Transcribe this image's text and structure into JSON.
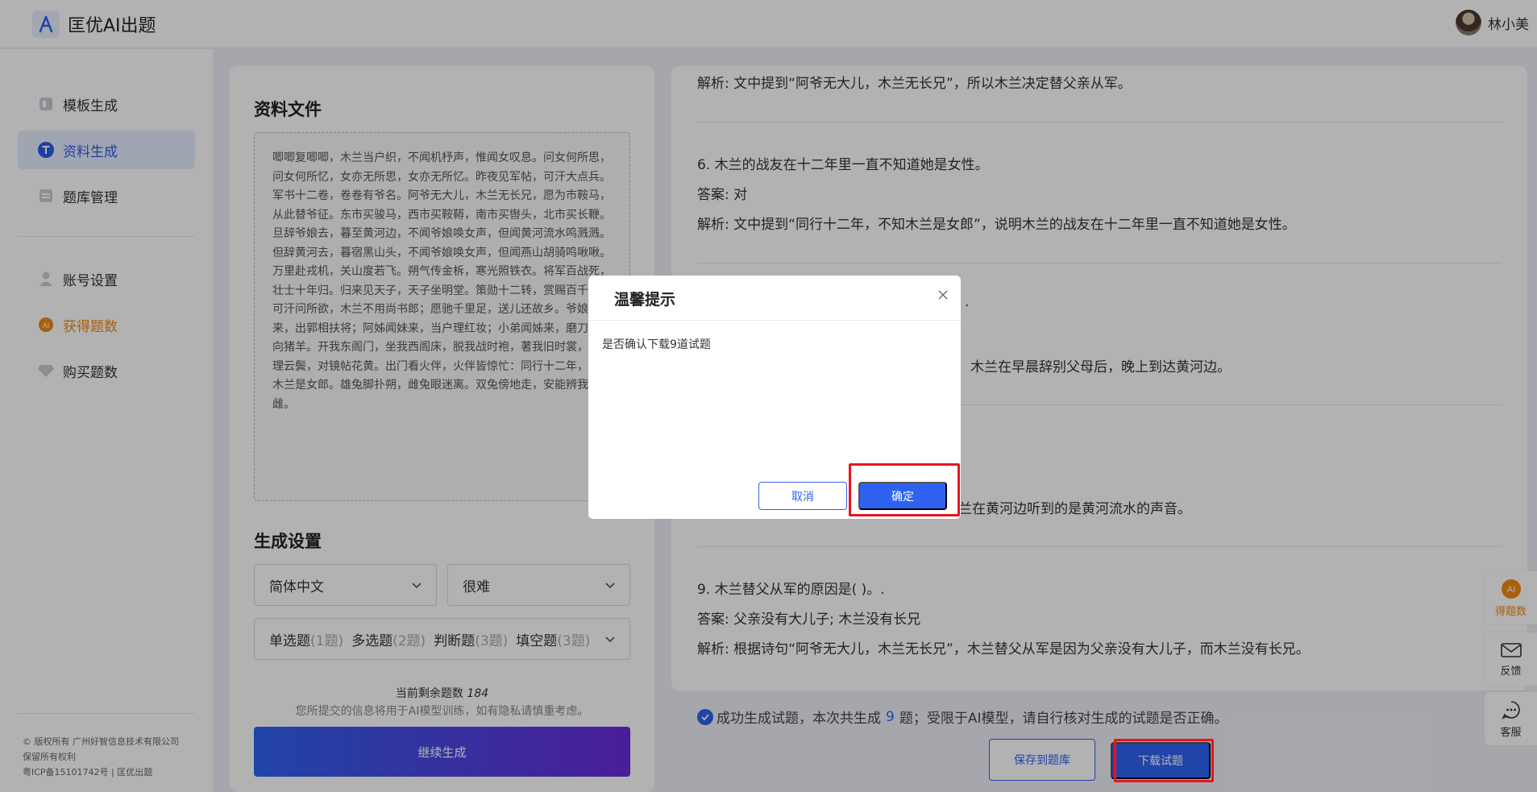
{
  "app": {
    "title": "匡优AI出题",
    "user_name": "林小美"
  },
  "sidebar": {
    "items": [
      {
        "label": "模板生成",
        "icon": "template-icon"
      },
      {
        "label": "资料生成",
        "icon": "text-t-icon"
      },
      {
        "label": "题库管理",
        "icon": "database-icon"
      },
      {
        "label": "账号设置",
        "icon": "user-icon"
      },
      {
        "label": "获得题数",
        "icon": "ai-coin-icon"
      },
      {
        "label": "购买题数",
        "icon": "diamond-icon"
      }
    ],
    "footer": [
      "© 版权所有 广州好智信息技术有限公司",
      "保留所有权利",
      "粤ICP备15101742号 | 匡优出题"
    ]
  },
  "left_panel": {
    "material_title": "资料文件",
    "material_text": "唧唧复唧唧，木兰当户织，不闻机杼声，惟闻女叹息。问女何所思，问女何所忆，女亦无所思，女亦无所忆。昨夜见军帖，可汗大点兵。军书十二卷，卷卷有爷名。阿爷无大儿，木兰无长兄，愿为市鞍马，从此替爷征。东市买骏马，西市买鞍鞯，南市买辔头，北市买长鞭。旦辞爷娘去，暮至黄河边，不闻爷娘唤女声，但闻黄河流水鸣溅溅。但辞黄河去，暮宿黑山头，不闻爷娘唤女声，但闻燕山胡骑鸣啾啾。万里赴戎机，关山度若飞。朔气传金柝，寒光照铁衣。将军百战死，壮士十年归。归来见天子，天子坐明堂。策勋十二转，赏赐百千强。可汗问所欲，木兰不用尚书郎；愿驰千里足，送儿还故乡。爷娘闻女来，出郭相扶将；阿姊闻妹来，当户理红妆；小弟闻姊来，磨刀霍霍向猪羊。开我东阁门，坐我西阁床，脱我战时袍，著我旧时裳，当窗理云鬓，对镜帖花黄。出门看火伴，火伴皆惊忙：同行十二年，不知木兰是女郎。雄兔脚扑朔，雌兔眼迷离。双兔傍地走，安能辨我是雄雌。",
    "settings_title": "生成设置",
    "language": "简体中文",
    "difficulty": "很难",
    "question_types": [
      {
        "label": "单选题",
        "count": "(1题)"
      },
      {
        "label": "多选题",
        "count": "(2题)"
      },
      {
        "label": "判断题",
        "count": "(3题)"
      },
      {
        "label": "填空题",
        "count": "(3题)"
      }
    ],
    "remaining_label": "当前剩余题数",
    "remaining_count": "184",
    "privacy_note": "您所提交的信息将用于AI模型训练，如有隐私请慎重考虑。",
    "continue_label": "继续生成"
  },
  "right_panel": {
    "lines": {
      "q5_analysis": "解析: 文中提到“阿爷无大儿，木兰无长兄”，所以木兰决定替父亲从军。",
      "q6_question": "6. 木兰的战友在十二年里一直不知道她是女性。",
      "q6_answer": "答案: 对",
      "q6_analysis": "解析: 文中提到“同行十二年，不知木兰是女郎”，说明木兰的战友在十二年里一直不知道她是女性。",
      "q7_question_tail": ".",
      "q7_analysis_tail": "木兰在早晨辞别父母后，晚上到达黄河边。",
      "q8_analysis_tail": "兰在黄河边听到的是黄河流水的声音。",
      "q9_question": "9. 木兰替父从军的原因是( )。.",
      "q9_answer": "答案: 父亲没有大儿子; 木兰没有长兄",
      "q9_analysis": "解析: 根据诗句“阿爷无大儿，木兰无长兄”，木兰替父从军是因为父亲没有大儿子，而木兰没有长兄。"
    },
    "status_prefix": "成功生成试题，本次共生成",
    "status_count": "9",
    "status_suffix": "题；受限于AI模型，请自行核对生成的试题是否正确。",
    "save_label": "保存到题库",
    "download_label": "下载试题"
  },
  "floating": [
    {
      "label": "得题数",
      "icon": "ai-coin-icon"
    },
    {
      "label": "反馈",
      "icon": "mail-icon"
    },
    {
      "label": "客服",
      "icon": "chat-icon"
    }
  ],
  "modal": {
    "title": "温馨提示",
    "message": "是否确认下载9道试题",
    "cancel_label": "取消",
    "confirm_label": "确定"
  },
  "colors": {
    "primary": "#2f62f0",
    "orange": "#ef8a12",
    "highlight": "#e8141e"
  }
}
